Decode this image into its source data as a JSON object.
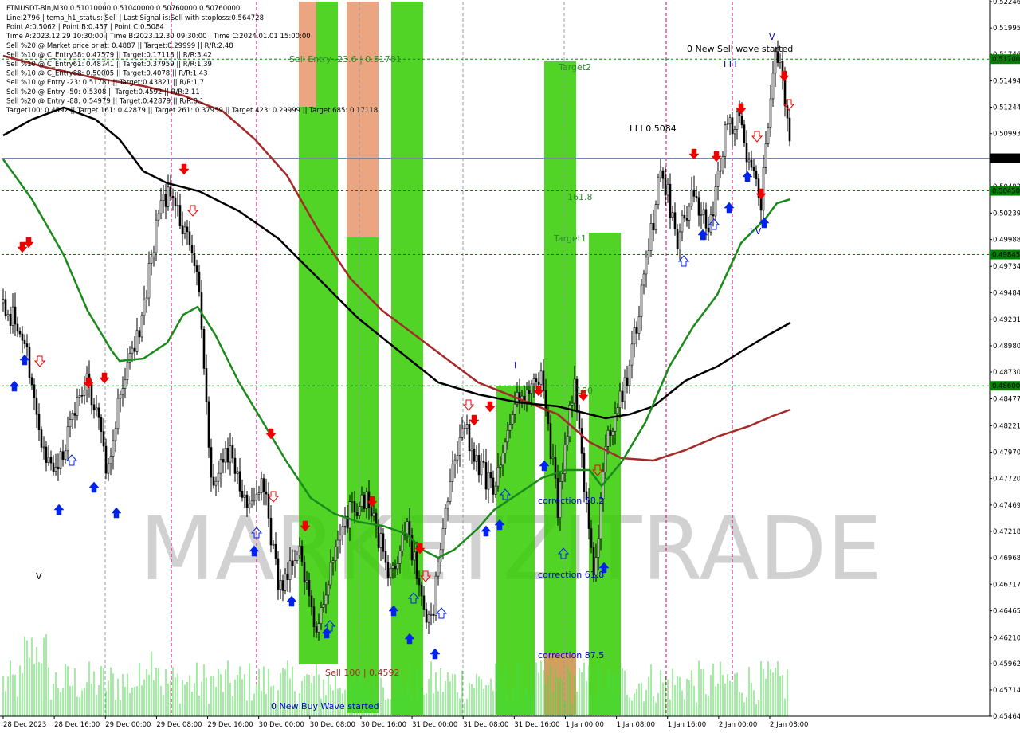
{
  "chart_data": {
    "type": "candlestick",
    "symbol_header": "FTMUSDT-Bin,M30  0.51010000 0.51040000 0.50760000 0.50760000",
    "info_lines": [
      "Line:2796 | tema_h1_status: Sell | Last Signal is:Sell with stoploss:0.564728",
      "Point A:0.5062 | Point B:0.457 | Point C:0.5084",
      "Time A:2023.12.29 10:30:00 | Time B:2023.12.30 09:30:00 | Time C:2024.01.01 15:00:00",
      "Sell %20 @ Market price or at: 0.4887 || Target:0.29999 || R/R:2.48",
      "Sell %10 @ C_Entry38: 0.47579 || Target:0.17118 || R/R:3.42",
      "Sell %10 @ C_Entry61: 0.48741 || Target:0.37959 || R/R:1.39",
      "Sell %10 @ C_Entry88: 0.50005 || Target:0.4078 || R/R:1.43",
      "Sell %10 @ Entry -23: 0.51781 || Target:0.43821 || R/R:1.7",
      "Sell %20 @ Entry -50: 0.5308 || Target:0.4592 || R/R:2.11",
      "Sell %20 @ Entry -88: 0.54979 || Target:0.42879 || R/R:8.1",
      "Target100: 0.4592 || Target 161: 0.42879 || Target 261: 0.37959 || Target 423: 0.29999 || Target 685: 0.17118"
    ],
    "y_ticks": [
      "0.52246",
      "0.51995",
      "0.51746",
      "0.51494",
      "0.51244",
      "0.50993",
      "0.50743",
      "0.50492",
      "0.50239",
      "0.49988",
      "0.49734",
      "0.49484",
      "0.49231",
      "0.48980",
      "0.48730",
      "0.48477",
      "0.48221",
      "0.47970",
      "0.47720",
      "0.47469",
      "0.47218",
      "0.46968",
      "0.46717",
      "0.46465",
      "0.46210",
      "0.45962",
      "0.45714",
      "0.45464"
    ],
    "x_ticks": [
      "28 Dec 2023",
      "28 Dec 16:00",
      "29 Dec 00:00",
      "29 Dec 08:00",
      "29 Dec 16:00",
      "30 Dec 00:00",
      "30 Dec 08:00",
      "30 Dec 16:00",
      "31 Dec 00:00",
      "31 Dec 08:00",
      "31 Dec 16:00",
      "1 Jan 00:00",
      "1 Jan 08:00",
      "1 Jan 16:00",
      "2 Jan 00:00",
      "2 Jan 08:00"
    ],
    "y_range": [
      0.45464,
      0.52246
    ],
    "current_price": "0.50760",
    "levels": [
      {
        "label": "0.51700",
        "value": 0.517,
        "color": "#008000"
      },
      {
        "label": "0.50450",
        "value": 0.5045,
        "color": "#008000"
      },
      {
        "label": "0.49845",
        "value": 0.49845,
        "color": "#008000"
      },
      {
        "label": "0.48600",
        "value": 0.486,
        "color": "#008000"
      }
    ],
    "annotations": {
      "sell_entry": "Sell Entry -23.6 | 0.51781",
      "target2": "Target2",
      "target1": "Target1",
      "fib_161": "161.8",
      "point_c": "I I I 0.5084",
      "new_sell_wave": "0 New Sell wave started",
      "new_buy_wave": "0 New Buy Wave started",
      "sell_100": "Sell 100 | 0.4592",
      "correction_38": "correction 38.2",
      "correction_61": "correction 61.8",
      "correction_87": "correction 87.5",
      "label_100": "100",
      "v_top": "V",
      "v_low": "V",
      "iii_top": "I I I",
      "ii_low": "I V",
      "i_mark": "I"
    },
    "watermark": "MARKETZITRADE",
    "colors": {
      "bull_zone": "#33cc00",
      "bear_zone": "#e8956a",
      "ma_black": "#000000",
      "ma_brown": "#a52a2a",
      "ma_green": "#1a8a1a",
      "level_line": "#008000",
      "sell_arrow": "#ee0000",
      "buy_arrow": "#0022ee"
    }
  }
}
